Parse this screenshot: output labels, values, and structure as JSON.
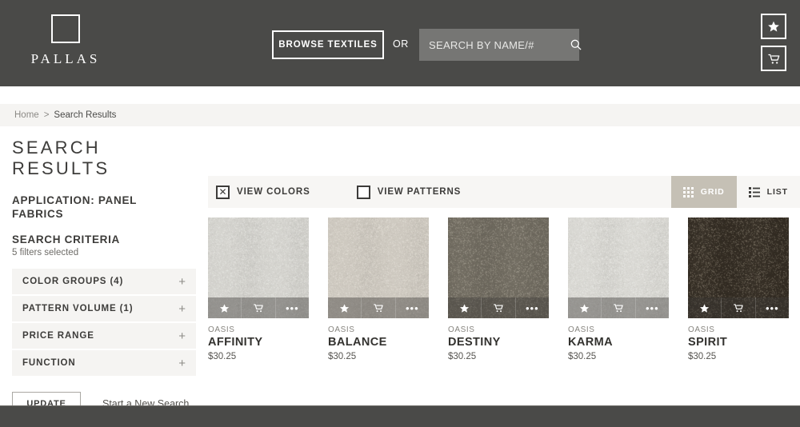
{
  "header": {
    "logo_text": "PALLAS",
    "logo_icon": "square-outline-icon",
    "browse_button": "BROWSE TEXTILES",
    "or_text": "OR",
    "search_placeholder": "SEARCH BY NAME/#",
    "search_value": "",
    "search_icon": "search-icon",
    "favorites_icon": "star-icon",
    "cart_icon": "shopping-cart-icon",
    "background": "#4a4a48"
  },
  "breadcrumb": {
    "home": "Home",
    "separator": ">",
    "current": "Search Results"
  },
  "sidebar": {
    "title": "SEARCH RESULTS",
    "application_label": "APPLICATION: PANEL FABRICS",
    "criteria_title": "SEARCH CRITERIA",
    "criteria_subtitle": "5 filters selected",
    "filters": [
      {
        "label": "COLOR GROUPS (4)",
        "expand_icon": "+"
      },
      {
        "label": "PATTERN VOLUME (1)",
        "expand_icon": "+"
      },
      {
        "label": "PRICE RANGE",
        "expand_icon": "+"
      },
      {
        "label": "FUNCTION",
        "expand_icon": "+"
      }
    ],
    "update_button": "UPDATE",
    "new_search_link": "Start a New Search"
  },
  "toolbar": {
    "view_colors": {
      "label": "VIEW COLORS",
      "checked": true,
      "mark": "✕"
    },
    "view_patterns": {
      "label": "VIEW PATTERNS",
      "checked": false,
      "mark": ""
    },
    "grid_button": {
      "label": "GRID",
      "icon": "grid-icon",
      "active": true
    },
    "list_button": {
      "label": "LIST",
      "icon": "list-icon",
      "active": false
    },
    "active_color": "#c5c0b5"
  },
  "products": [
    {
      "brand": "OASIS",
      "name": "AFFINITY",
      "price": "$30.25",
      "base_color": "#d3d2cd",
      "speck_color": "#eeeeea",
      "favorite_icon": "star-icon",
      "cart_icon": "shopping-cart-icon",
      "more_icon": "ellipsis-icon"
    },
    {
      "brand": "OASIS",
      "name": "BALANCE",
      "price": "$30.25",
      "base_color": "#cdc8bf",
      "speck_color": "#eae6de",
      "favorite_icon": "star-icon",
      "cart_icon": "shopping-cart-icon",
      "more_icon": "ellipsis-icon"
    },
    {
      "brand": "OASIS",
      "name": "DESTINY",
      "price": "$30.25",
      "base_color": "#6f6a5f",
      "speck_color": "#b6b0a2",
      "favorite_icon": "star-icon",
      "cart_icon": "shopping-cart-icon",
      "more_icon": "ellipsis-icon"
    },
    {
      "brand": "OASIS",
      "name": "KARMA",
      "price": "$30.25",
      "base_color": "#d8d7d2",
      "speck_color": "#f1f1ee",
      "favorite_icon": "star-icon",
      "cart_icon": "shopping-cart-icon",
      "more_icon": "ellipsis-icon"
    },
    {
      "brand": "OASIS",
      "name": "SPIRIT",
      "price": "$30.25",
      "base_color": "#332c23",
      "speck_color": "#9e9483",
      "favorite_icon": "star-icon",
      "cart_icon": "shopping-cart-icon",
      "more_icon": "ellipsis-icon"
    }
  ],
  "footer": {
    "background": "#4a4a48"
  }
}
